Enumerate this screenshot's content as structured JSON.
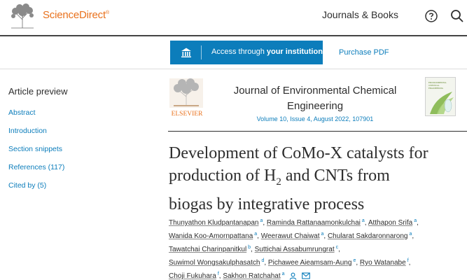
{
  "header": {
    "brand": "ScienceDirect",
    "brand_mark": "®",
    "journals_link": "Journals & Books",
    "icons": {
      "help": "help-icon",
      "search": "search-icon"
    }
  },
  "access": {
    "button_prefix": "Access through ",
    "button_bold": "your institution",
    "purchase": "Purchase PDF",
    "icon": "institution-icon"
  },
  "sidebar": {
    "title": "Article preview",
    "items": [
      {
        "label": "Abstract"
      },
      {
        "label": "Introduction"
      },
      {
        "label": "Section snippets"
      },
      {
        "label": "References (117)"
      },
      {
        "label": "Cited by (5)"
      }
    ]
  },
  "journal": {
    "publisher": "ELSEVIER",
    "name_line1": "Journal of Environmental Chemical",
    "name_line2": "Engineering",
    "volume_link": "Volume 10, Issue 4",
    "meta_rest": ", August 2022, 107901",
    "cover_text_line1": "ENVIRONMENTAL",
    "cover_text_line2": "CHEMICAL",
    "cover_text_line3": "ENGINEERING"
  },
  "article": {
    "title_line1": "Development of CoMo-X catalysts for",
    "title_line2_a": "production of H",
    "title_line2_sub": "2",
    "title_line2_b": " and CNTs from",
    "title_line3": "biogas by integrative process"
  },
  "authors": [
    {
      "name": "Thunyathon Kludpantanapan",
      "aff": "a"
    },
    {
      "name": "Raminda Rattanaamonkulchai",
      "aff": "a"
    },
    {
      "name": "Atthapon Srifa",
      "aff": "a"
    },
    {
      "name": "Wanida Koo-Amornpattana",
      "aff": "a"
    },
    {
      "name": "Weerawut Chaiwat",
      "aff": "a"
    },
    {
      "name": "Chularat Sakdaronnarong",
      "aff": "a"
    },
    {
      "name": "Tawatchai Charinpanitkul",
      "aff": "b"
    },
    {
      "name": "Suttichai Assabumrungrat",
      "aff": "c"
    },
    {
      "name": "Suwimol Wongsakulphasatch",
      "aff": "d"
    },
    {
      "name": "Pichawee Aieamsam-Aung",
      "aff": "e"
    },
    {
      "name": "Ryo Watanabe",
      "aff": "f"
    },
    {
      "name": "Choji Fukuhara",
      "aff": "f"
    },
    {
      "name": "Sakhon Ratchahat",
      "aff": "a"
    }
  ],
  "colors": {
    "brand_orange": "#e9711c",
    "link_blue": "#0c7dbb",
    "text": "#2e2e2e"
  }
}
